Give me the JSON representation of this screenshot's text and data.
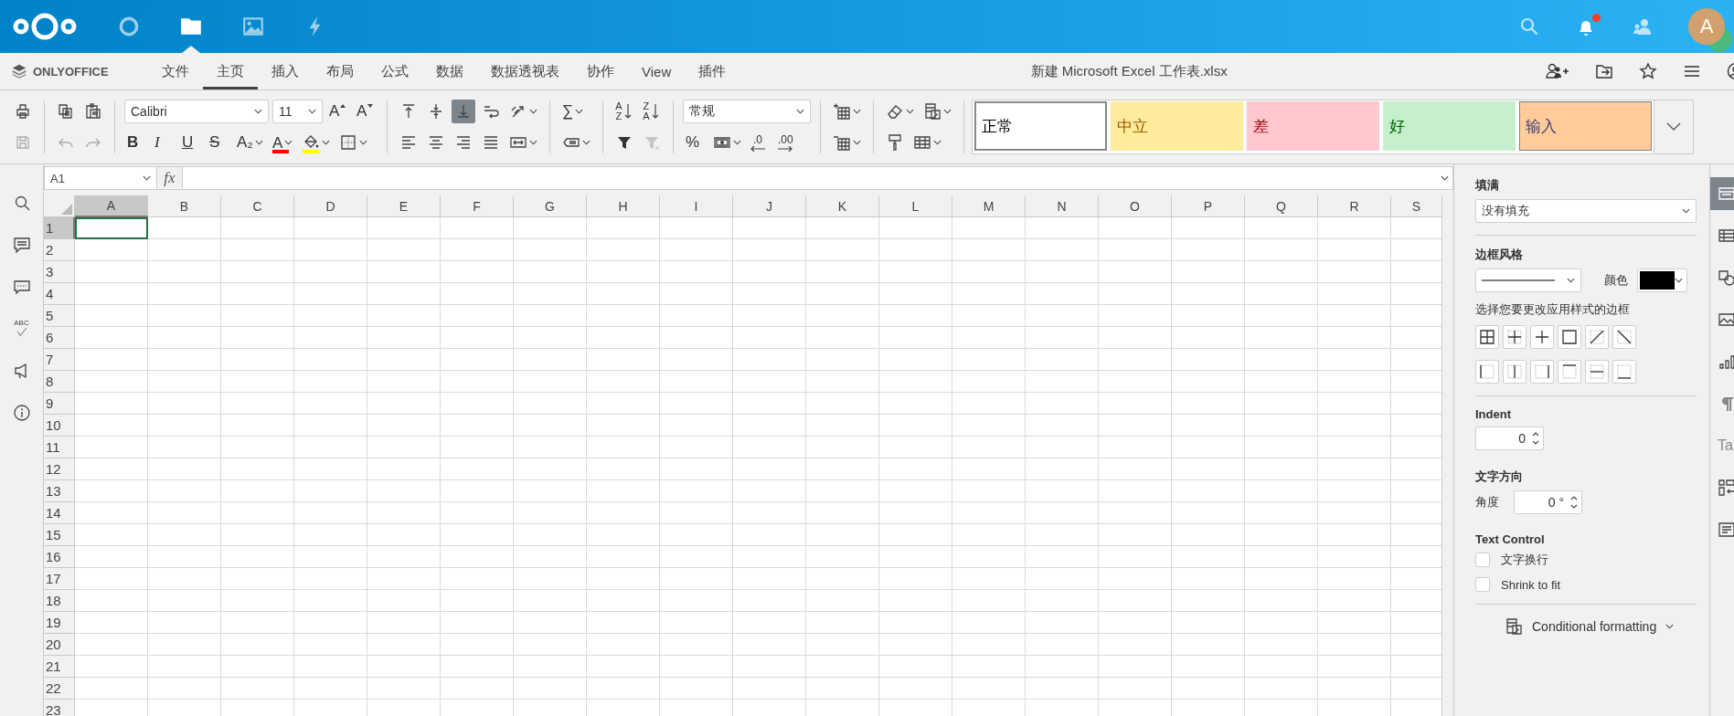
{
  "header": {
    "apps": [
      {
        "kind": "dashboard",
        "selected": false
      },
      {
        "kind": "files",
        "selected": true
      },
      {
        "kind": "photos",
        "selected": false
      },
      {
        "kind": "activity",
        "selected": false
      }
    ],
    "notifications_unread": true,
    "avatar_initial": "A"
  },
  "brand": "ONLYOFFICE",
  "menu_tabs": [
    {
      "label": "文件",
      "selected": false
    },
    {
      "label": "主页",
      "selected": true
    },
    {
      "label": "插入",
      "selected": false
    },
    {
      "label": "布局",
      "selected": false
    },
    {
      "label": "公式",
      "selected": false
    },
    {
      "label": "数据",
      "selected": false
    },
    {
      "label": "数据透视表",
      "selected": false
    },
    {
      "label": "协作",
      "selected": false
    },
    {
      "label": "View",
      "selected": false
    },
    {
      "label": "插件",
      "selected": false
    }
  ],
  "document_title": "新建 Microsoft Excel 工作表.xlsx",
  "toolbar": {
    "groups": [
      {
        "top": [
          {
            "kind": "print",
            "active": false,
            "disabled": false
          }
        ],
        "bottom": [
          {
            "kind": "save",
            "active": false,
            "disabled": true
          }
        ]
      },
      {
        "top": [
          {
            "kind": "copy",
            "active": false,
            "disabled": false
          },
          {
            "kind": "paste",
            "active": false,
            "disabled": false
          }
        ],
        "bottom": [
          {
            "kind": "undo",
            "active": false,
            "disabled": true
          },
          {
            "kind": "redo",
            "active": false,
            "disabled": true
          }
        ]
      },
      {
        "top": [
          {
            "kind": "font-combo",
            "value": "Calibri"
          },
          {
            "kind": "size-combo",
            "value": "11"
          },
          {
            "kind": "grow",
            "label": "A",
            "active": false,
            "disabled": false
          },
          {
            "kind": "shrink",
            "label": "A",
            "active": false,
            "disabled": false
          }
        ],
        "bottom": [
          {
            "kind": "bold",
            "label": "B",
            "active": false,
            "disabled": false
          },
          {
            "kind": "italic",
            "label": "I",
            "active": false,
            "disabled": false
          },
          {
            "kind": "underline",
            "label": "U",
            "active": false,
            "disabled": false
          },
          {
            "kind": "strike",
            "label": "S",
            "active": false,
            "disabled": false
          },
          {
            "kind": "subscript",
            "label": "A₂",
            "active": false,
            "disabled": false
          },
          {
            "kind": "font-color",
            "label": "A",
            "color": "#ff0000",
            "active": false,
            "disabled": false
          },
          {
            "kind": "fill",
            "color": "#ffff00",
            "active": false,
            "disabled": false
          },
          {
            "kind": "borders",
            "active": false,
            "disabled": false
          }
        ]
      },
      {
        "top": [
          {
            "kind": "valign-top",
            "active": false,
            "disabled": false
          },
          {
            "kind": "valign-middle",
            "active": false,
            "disabled": false
          },
          {
            "kind": "valign-bottom",
            "active": true,
            "disabled": false
          },
          {
            "kind": "wrap",
            "active": false,
            "disabled": false
          },
          {
            "kind": "orientation",
            "active": false,
            "disabled": false
          }
        ],
        "bottom": [
          {
            "kind": "align-left",
            "active": false,
            "disabled": false
          },
          {
            "kind": "align-center",
            "active": false,
            "disabled": false
          },
          {
            "kind": "align-right",
            "active": false,
            "disabled": false
          },
          {
            "kind": "justify",
            "active": false,
            "disabled": false
          },
          {
            "kind": "merge",
            "active": false,
            "disabled": false
          }
        ]
      },
      {
        "top": [
          {
            "kind": "sum",
            "label": "∑",
            "active": false,
            "disabled": false
          }
        ],
        "bottom": [
          {
            "kind": "named-range",
            "active": false,
            "disabled": false
          }
        ]
      },
      {
        "top": [
          {
            "kind": "sort-asc",
            "label": "AZ",
            "active": false,
            "disabled": false
          },
          {
            "kind": "sort-desc",
            "label": "ZA",
            "active": false,
            "disabled": false
          }
        ],
        "bottom": [
          {
            "kind": "filter",
            "active": false,
            "disabled": false
          },
          {
            "kind": "clear-filter",
            "active": false,
            "disabled": true
          }
        ]
      },
      {
        "top": [
          {
            "kind": "format-combo",
            "value": "常规"
          }
        ],
        "bottom": [
          {
            "kind": "percent",
            "label": "%",
            "active": false,
            "disabled": false
          },
          {
            "kind": "currency",
            "active": false,
            "disabled": false
          },
          {
            "kind": "decrease-decimal",
            "label": ".0",
            "active": false,
            "disabled": false
          },
          {
            "kind": "increase-decimal",
            "label": ".00",
            "active": false,
            "disabled": false
          }
        ]
      },
      {
        "top": [
          {
            "kind": "insert-cells",
            "active": false,
            "disabled": false
          }
        ],
        "bottom": [
          {
            "kind": "delete-cells",
            "active": false,
            "disabled": false
          }
        ]
      },
      {
        "top": [
          {
            "kind": "clear",
            "active": false,
            "disabled": false
          },
          {
            "kind": "conditional",
            "active": false,
            "disabled": false
          }
        ],
        "bottom": [
          {
            "kind": "copy-style",
            "active": false,
            "disabled": false
          },
          {
            "kind": "table",
            "active": false,
            "disabled": false
          }
        ]
      }
    ]
  },
  "cell_styles": [
    {
      "label": "正常",
      "kind": "normal",
      "color": "#ffffff",
      "selected": true
    },
    {
      "label": "中立",
      "kind": "neutral",
      "color": "#ffeb9c",
      "selected": false
    },
    {
      "label": "差",
      "kind": "bad",
      "color": "#ffc7ce",
      "selected": false
    },
    {
      "label": "好",
      "kind": "good",
      "color": "#c6efce",
      "selected": false
    },
    {
      "label": "输入",
      "kind": "input",
      "color": "#ffcc99",
      "selected": false
    }
  ],
  "left_sidebar": [
    {
      "kind": "search"
    },
    {
      "kind": "comments"
    },
    {
      "kind": "chat"
    },
    {
      "kind": "spellcheck",
      "label": "ABC"
    },
    {
      "kind": "feedback"
    },
    {
      "kind": "about"
    }
  ],
  "formula_bar": {
    "cell_name": "A1",
    "function_label": "fx"
  },
  "sheet": {
    "columns": [
      {
        "label": "A",
        "selected": true
      },
      {
        "label": "B",
        "selected": false
      },
      {
        "label": "C",
        "selected": false
      },
      {
        "label": "D",
        "selected": false
      },
      {
        "label": "E",
        "selected": false
      },
      {
        "label": "F",
        "selected": false
      },
      {
        "label": "G",
        "selected": false
      },
      {
        "label": "H",
        "selected": false
      },
      {
        "label": "I",
        "selected": false
      },
      {
        "label": "J",
        "selected": false
      },
      {
        "label": "K",
        "selected": false
      },
      {
        "label": "L",
        "selected": false
      },
      {
        "label": "M",
        "selected": false
      },
      {
        "label": "N",
        "selected": false
      },
      {
        "label": "O",
        "selected": false
      },
      {
        "label": "P",
        "selected": false
      },
      {
        "label": "Q",
        "selected": false
      },
      {
        "label": "R",
        "selected": false
      },
      {
        "label": "S",
        "selected": false
      }
    ],
    "rows": [
      {
        "label": "1",
        "selected": true
      },
      {
        "label": "2",
        "selected": false
      },
      {
        "label": "3",
        "selected": false
      },
      {
        "label": "4",
        "selected": false
      },
      {
        "label": "5",
        "selected": false
      },
      {
        "label": "6",
        "selected": false
      },
      {
        "label": "7",
        "selected": false
      },
      {
        "label": "8",
        "selected": false
      },
      {
        "label": "9",
        "selected": false
      },
      {
        "label": "10",
        "selected": false
      },
      {
        "label": "11",
        "selected": false
      },
      {
        "label": "12",
        "selected": false
      },
      {
        "label": "13",
        "selected": false
      },
      {
        "label": "14",
        "selected": false
      },
      {
        "label": "15",
        "selected": false
      },
      {
        "label": "16",
        "selected": false
      },
      {
        "label": "17",
        "selected": false
      },
      {
        "label": "18",
        "selected": false
      },
      {
        "label": "19",
        "selected": false
      },
      {
        "label": "20",
        "selected": false
      },
      {
        "label": "21",
        "selected": false
      },
      {
        "label": "22",
        "selected": false
      },
      {
        "label": "23",
        "selected": false
      }
    ]
  },
  "right_panel": {
    "fill_label": "填满",
    "fill_value": "没有填充",
    "border_style_label": "边框风格",
    "color_label": "颜色",
    "border_hint": "选择您要更改应用样式的边框",
    "indent_label": "Indent",
    "indent_value": "0",
    "direction_label": "文字方向",
    "angle_label": "角度",
    "angle_value": "0 °",
    "text_control_label": "Text Control",
    "checkboxes": [
      {
        "label": "文字换行",
        "checked": false
      },
      {
        "label": "Shrink to fit",
        "checked": false
      }
    ],
    "conditional_formatting": "Conditional formatting"
  },
  "right_tabs": [
    {
      "kind": "cell",
      "selected": true
    },
    {
      "kind": "table",
      "selected": false
    },
    {
      "kind": "shape",
      "selected": false
    },
    {
      "kind": "image",
      "selected": false
    },
    {
      "kind": "chart",
      "selected": false
    },
    {
      "kind": "paragraph",
      "selected": false
    },
    {
      "kind": "text-art",
      "label": "Ta",
      "selected": false
    },
    {
      "kind": "pivot",
      "selected": false
    },
    {
      "kind": "signature",
      "selected": false
    }
  ]
}
